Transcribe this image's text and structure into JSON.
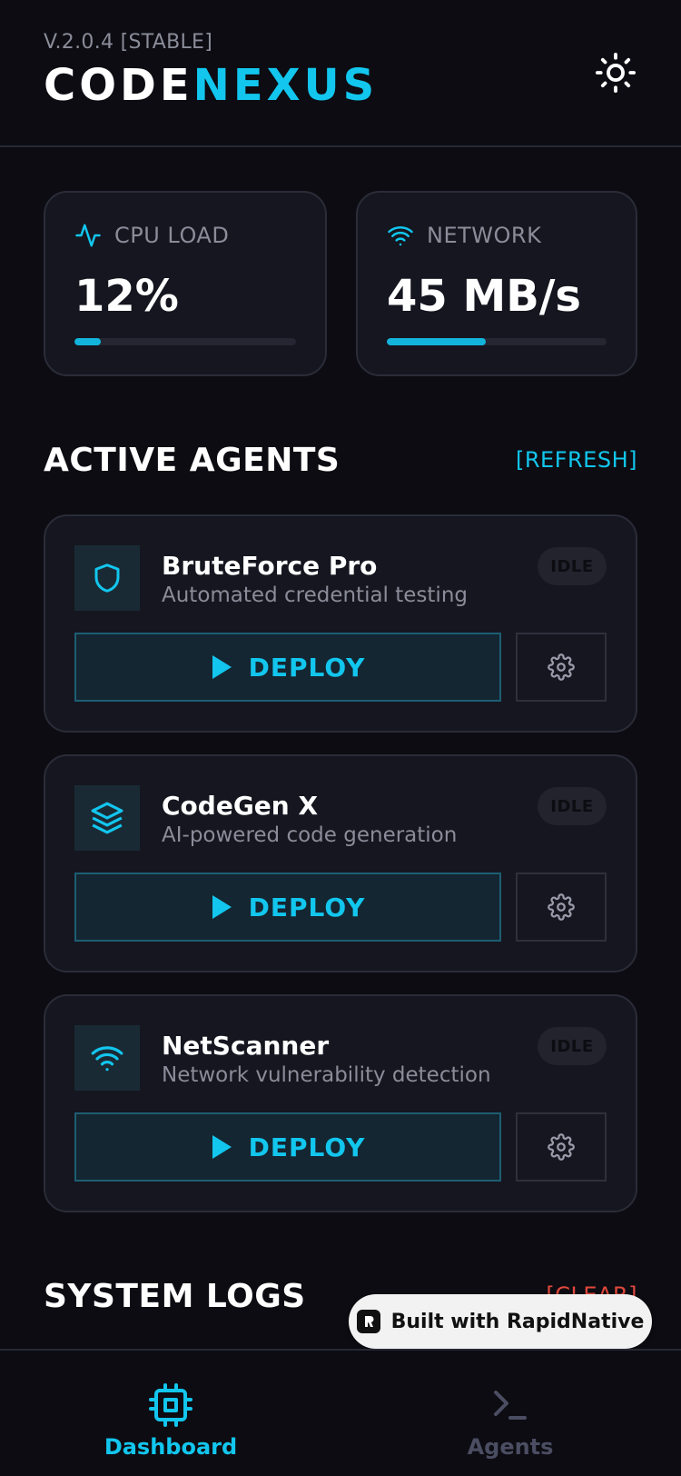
{
  "header": {
    "version": "V.2.0.4 [STABLE]",
    "brand_part1": "CODE",
    "brand_part2": "NEXUS",
    "theme_icon": "sun-icon"
  },
  "stats": {
    "cpu": {
      "label": "CPU LOAD",
      "value": "12%",
      "progress": 0.12,
      "icon": "activity-icon"
    },
    "network": {
      "label": "NETWORK",
      "value": "45 MB/s",
      "progress": 0.45,
      "icon": "wifi-icon"
    }
  },
  "agents_section": {
    "title": "ACTIVE AGENTS",
    "refresh_label": "[REFRESH]",
    "items": [
      {
        "name": "BruteForce Pro",
        "description": "Automated credential testing",
        "status": "IDLE",
        "deploy_label": "DEPLOY",
        "icon": "shield-icon"
      },
      {
        "name": "CodeGen X",
        "description": "AI-powered code generation",
        "status": "IDLE",
        "deploy_label": "DEPLOY",
        "icon": "layers-icon"
      },
      {
        "name": "NetScanner",
        "description": "Network vulnerability detection",
        "status": "IDLE",
        "deploy_label": "DEPLOY",
        "icon": "wifi-icon"
      }
    ]
  },
  "logs_section": {
    "title": "SYSTEM LOGS",
    "clear_label": "[CLEAR]"
  },
  "built_with": "Built with RapidNative",
  "nav": {
    "items": [
      {
        "label": "Dashboard",
        "icon": "cpu-icon",
        "active": true
      },
      {
        "label": "Agents",
        "icon": "terminal-icon",
        "active": false
      }
    ]
  },
  "colors": {
    "accent": "#12c6ee",
    "danger": "#e0483c",
    "background": "#0c0c12",
    "card": "#15161f"
  }
}
